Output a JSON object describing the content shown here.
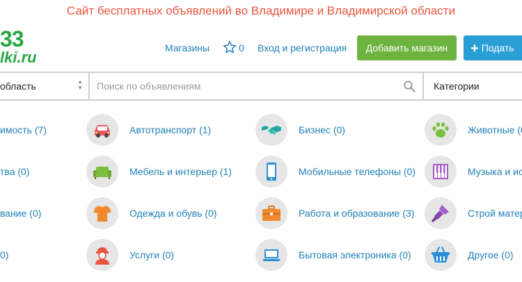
{
  "header": {
    "site_title": "Сайт бесплатных объявлений во Владимире и Владимирской области",
    "logo_line1": "33",
    "logo_line2": "lki.ru",
    "nav_shops": "Магазины",
    "favorites_count": "0",
    "nav_login": "Вход и регистрация",
    "add_shop_button": "Добавить магазин",
    "post_ad_button": "Подать"
  },
  "search": {
    "region_value": "область",
    "placeholder": "Поиск по объявлениям",
    "category_value": "Категории"
  },
  "categories": {
    "left_cut": [
      "имость (7)",
      "тва (0)",
      "вание (0)",
      "0)"
    ],
    "col1": [
      {
        "label": "Автотранспорт (1)",
        "icon": "car-icon"
      },
      {
        "label": "Мебель и интерьер (1)",
        "icon": "sofa-icon"
      },
      {
        "label": "Одежда и обувь (0)",
        "icon": "tshirt-icon"
      },
      {
        "label": "Услуги (0)",
        "icon": "worker-icon"
      }
    ],
    "col2": [
      {
        "label": "Бизнес (0)",
        "icon": "handshake-icon"
      },
      {
        "label": "Мобильные телефоны (0)",
        "icon": "phone-icon"
      },
      {
        "label": "Работа и образование (3)",
        "icon": "briefcase-icon"
      },
      {
        "label": "Бытовая электроника (0)",
        "icon": "laptop-icon"
      }
    ],
    "col3": [
      {
        "label": "Животные (0",
        "icon": "paw-icon"
      },
      {
        "label": "Музыка и ис",
        "icon": "piano-icon"
      },
      {
        "label": "Строй матер",
        "icon": "paint-brush-icon"
      },
      {
        "label": "Другое (0)",
        "icon": "basket-icon"
      }
    ]
  },
  "colors": {
    "title": "#e8553e",
    "logo": "#28a745",
    "link": "#1f7fb8",
    "green_button": "#6db33f",
    "blue_button": "#2a9fd6"
  }
}
